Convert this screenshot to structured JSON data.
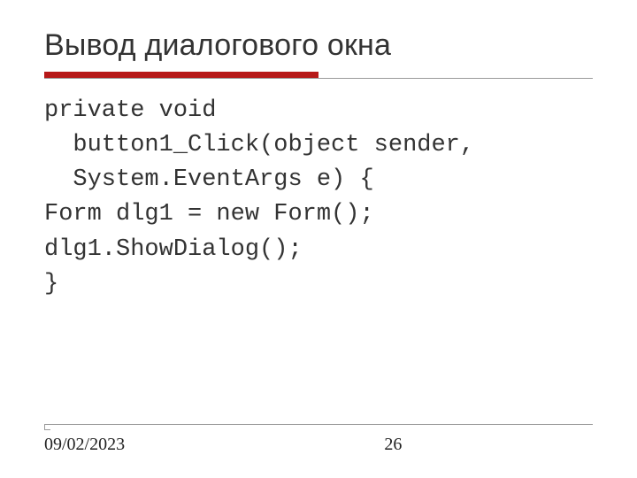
{
  "slide": {
    "title": "Вывод диалогового окна",
    "code": {
      "line1": "private void",
      "line2": "  button1_Click(object sender,",
      "line3": "  System.EventArgs e) {",
      "line4": "Form dlg1 = new Form();",
      "line5": "dlg1.ShowDialog();",
      "line6": "}"
    }
  },
  "footer": {
    "date": "09/02/2023",
    "page": "26"
  },
  "colors": {
    "accent": "#b61918"
  }
}
